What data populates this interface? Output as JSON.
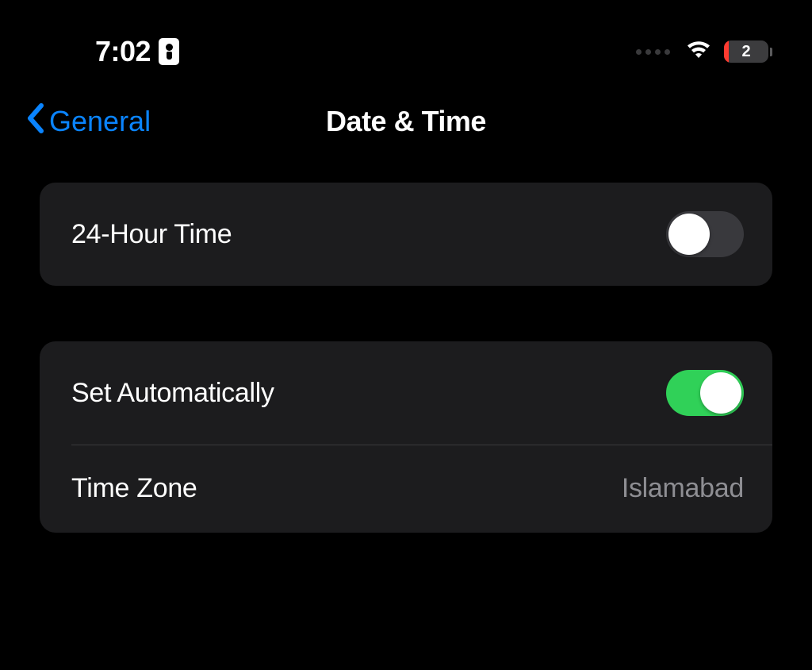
{
  "status": {
    "time": "7:02",
    "battery_percent": "2"
  },
  "nav": {
    "back_label": "General",
    "title": "Date & Time"
  },
  "settings": {
    "group1": {
      "row1_label": "24-Hour Time",
      "row1_toggle": false
    },
    "group2": {
      "row1_label": "Set Automatically",
      "row1_toggle": true,
      "row2_label": "Time Zone",
      "row2_value": "Islamabad"
    }
  }
}
